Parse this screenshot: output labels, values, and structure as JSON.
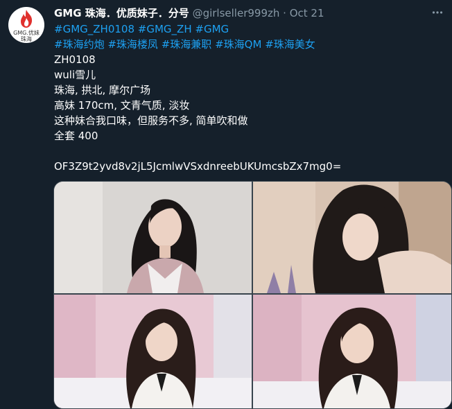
{
  "author": {
    "display_name": "GMG 珠海．优质妹子．分号",
    "handle": "@girlseller999zh",
    "separator": "·",
    "date": "Oct 21",
    "avatar_text_1": "GMG.优妹",
    "avatar_text_2": "珠海"
  },
  "tweet": {
    "hashtags_line1": [
      "#GMG_ZH0108",
      "#GMG_ZH",
      "#GMG"
    ],
    "hashtags_line2": [
      "#珠海约炮",
      "#珠海楼凤",
      "#珠海兼职",
      "#珠海QM",
      "#珠海美女"
    ],
    "lines": [
      "ZH0108",
      "wuli雪儿",
      "珠海, 拱北, 摩尔广场",
      "高妹 170cm, 文青气质, 淡妆",
      "这种妹合我口味，但服务不多, 简单吹和做",
      "全套 400"
    ],
    "code": "OF3Z9t2yvd8v2jL5JcmlwVSxdnreebUKUmcsbZx7mg0="
  },
  "colors": {
    "background": "#15202b",
    "link": "#1da1f2",
    "muted": "#8899a6",
    "border": "#38444d"
  },
  "icons": {
    "more": "more-dots-icon",
    "avatar_logo": "flame-icon"
  }
}
